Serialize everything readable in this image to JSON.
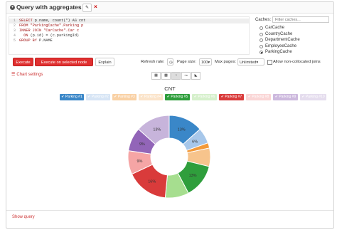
{
  "header": {
    "title": "Query with aggregates",
    "edit_icon": "pencil-icon",
    "close_icon": "close-icon"
  },
  "editor": {
    "line_numbers": [
      "1",
      "2",
      "3",
      "4",
      "5"
    ],
    "lines": [
      [
        "SELECT ",
        "p.name, count(*) AS cnt"
      ],
      [
        "FROM ",
        "\"ParkingCache\".Parking p"
      ],
      [
        "INNER JOIN ",
        "\"CarCache\".Car c"
      ],
      [
        "  ON ",
        "(p.id) = (c.parkingId)"
      ],
      [
        "GROUP BY ",
        "P.NAME"
      ]
    ]
  },
  "caches": {
    "label": "Caches:",
    "filter_placeholder": "Filter caches...",
    "options": [
      "CarCache",
      "CountryCache",
      "DepartmentCache",
      "EmployeeCache",
      "ParkingCache"
    ],
    "selected": "ParkingCache"
  },
  "toolbar": {
    "execute": "Execute",
    "execute_selected": "Execute on selected node",
    "explain": "Explain",
    "refresh_label": "Refresh rate:",
    "page_size_label": "Page size:",
    "page_size_value": "100",
    "max_pages_label": "Max pages:",
    "max_pages_value": "Unlimited",
    "allow_non_collocated": "Allow non-collocated joins"
  },
  "chart_settings": "Chart settings",
  "chart_data": {
    "type": "pie",
    "title": "CNT",
    "series": [
      {
        "name": "Parking #1",
        "value": 13,
        "color": "#3a87c8",
        "active": true
      },
      {
        "name": "Parking #2",
        "value": 6,
        "color": "#a7c7ea",
        "active": false
      },
      {
        "name": "Parking #3",
        "value": 2,
        "color": "#f39a3a",
        "active": false
      },
      {
        "name": "Parking #4",
        "value": 7,
        "color": "#f7c48c",
        "active": false
      },
      {
        "name": "Parking #5",
        "value": 13,
        "color": "#2f9e3c",
        "active": true
      },
      {
        "name": "Parking #6",
        "value": 9,
        "color": "#a6de8f",
        "active": false
      },
      {
        "name": "Parking #7",
        "value": 16,
        "color": "#d93b3b",
        "active": true
      },
      {
        "name": "Parking #8",
        "value": 9,
        "color": "#f5a5a5",
        "active": false
      },
      {
        "name": "Parking #9",
        "value": 9,
        "color": "#9265b8",
        "active": false
      },
      {
        "name": "Parking #10",
        "value": 13,
        "color": "#c7b4db",
        "active": false
      }
    ],
    "label_values": [
      "13%",
      "6%",
      "",
      "",
      "13%",
      "",
      "16%",
      "9%",
      "9%",
      "13%"
    ]
  },
  "footer": {
    "show_query": "Show query"
  }
}
